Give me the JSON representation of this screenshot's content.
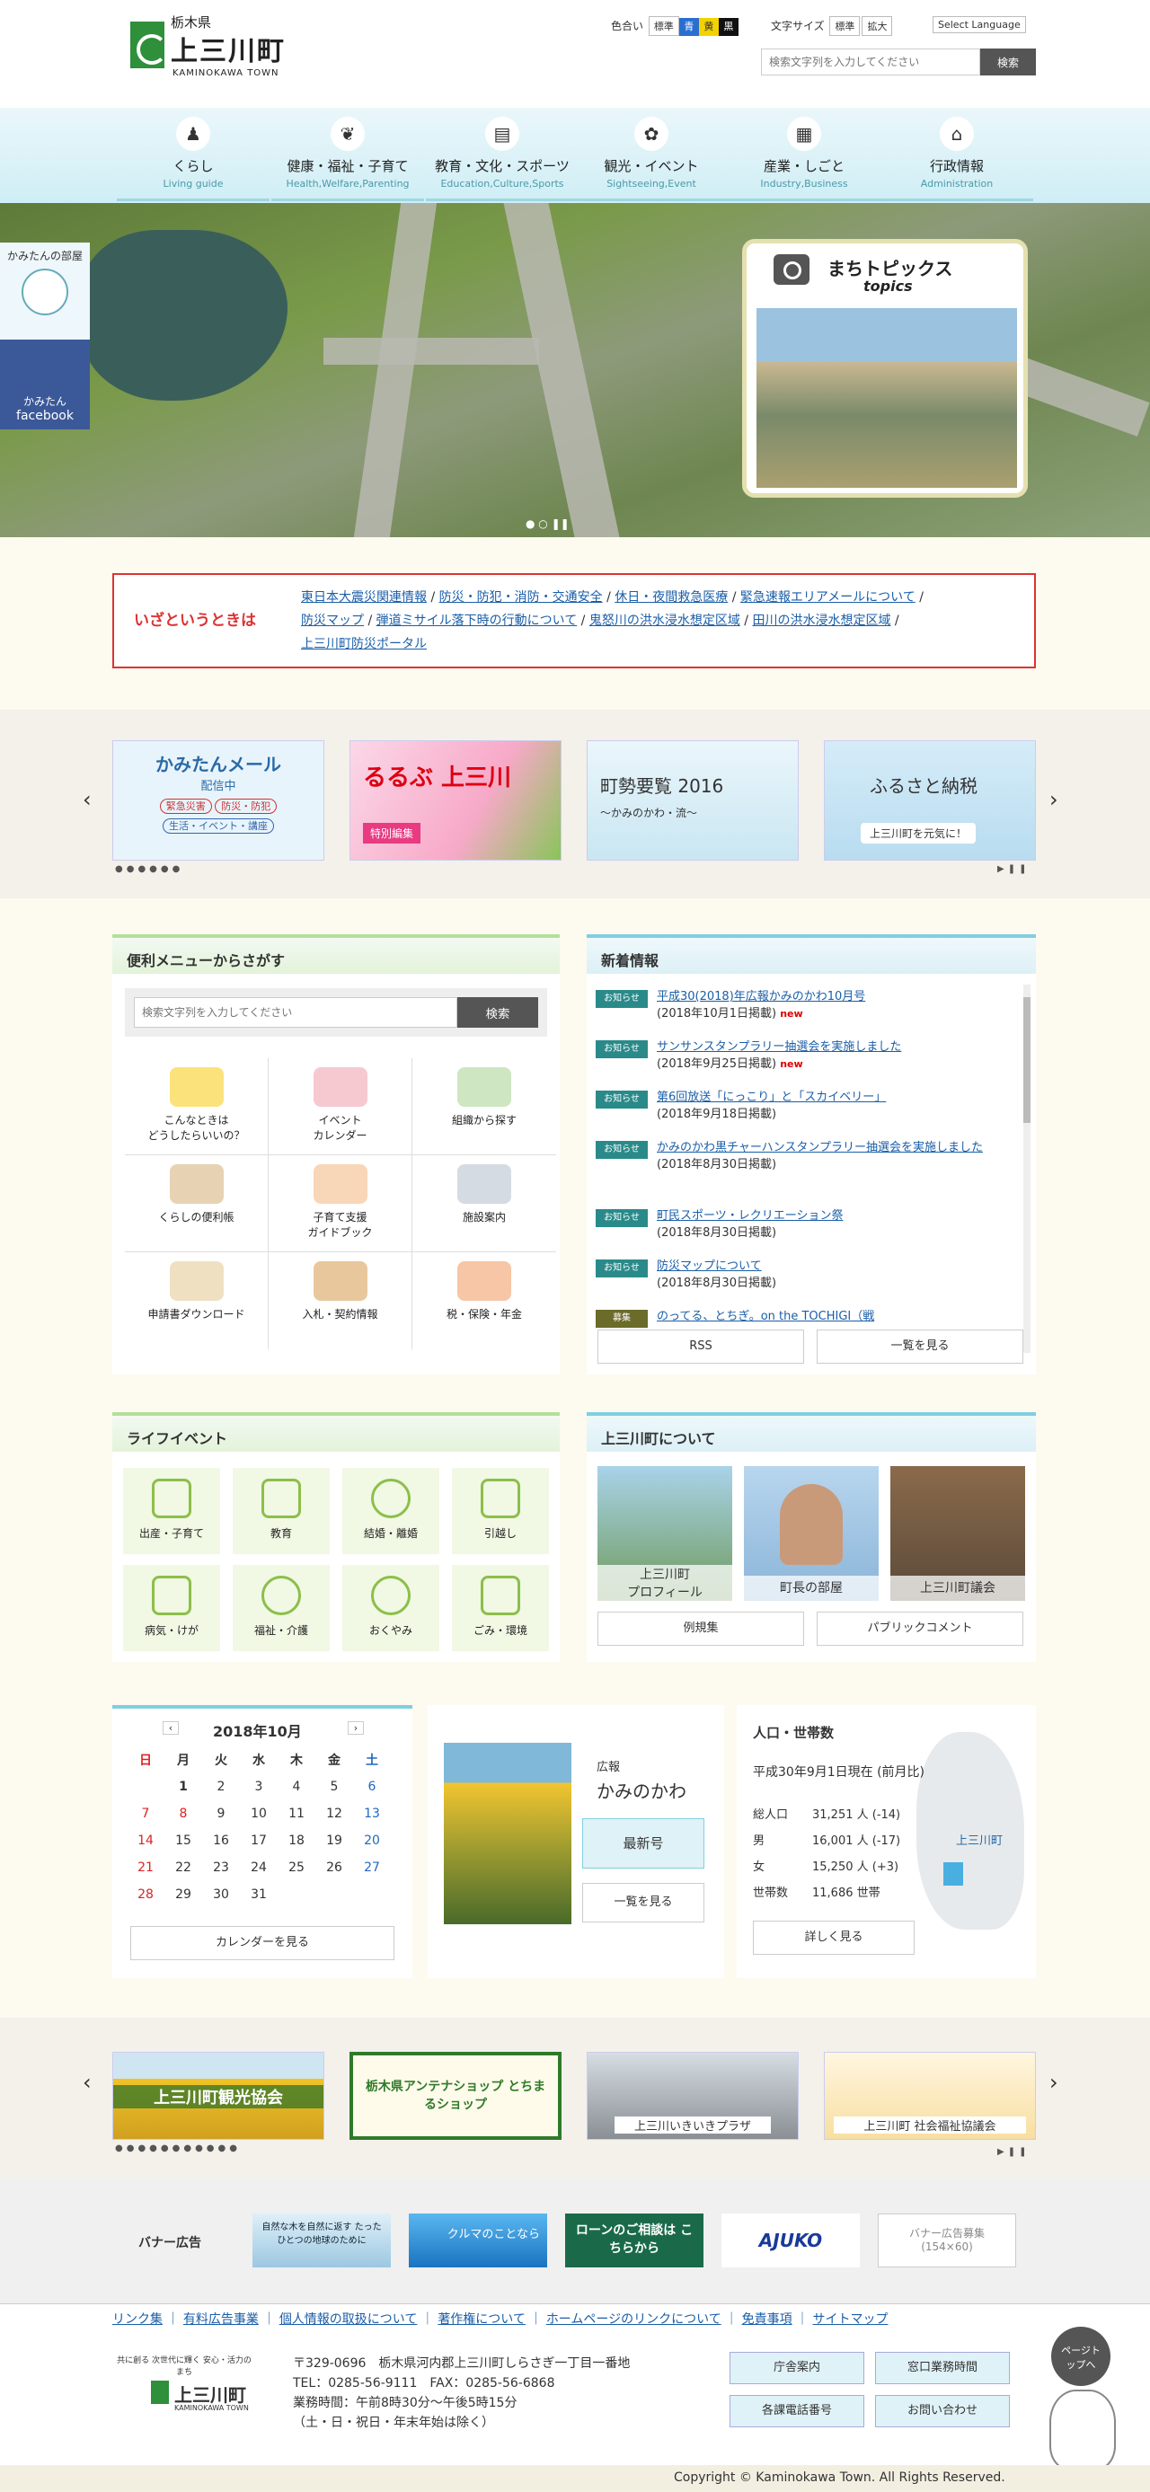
{
  "header": {
    "prefecture": "栃木県",
    "town_name": "上三川町",
    "town_name_en": "KAMINOKAWA TOWN",
    "color_label": "色合い",
    "color_options": [
      "標準",
      "青",
      "黄",
      "黒"
    ],
    "font_label": "文字サイズ",
    "font_options": [
      "標準",
      "拡大"
    ],
    "language": "Select Language",
    "search_placeholder": "検索文字列を入力してください",
    "search_button": "検索"
  },
  "nav": [
    {
      "jp": "くらし",
      "en": "Living guide",
      "icon": "person-icon"
    },
    {
      "jp": "健康・福祉・子育て",
      "en": "Health,Welfare,Parenting",
      "icon": "leaf-icon"
    },
    {
      "jp": "教育・文化・スポーツ",
      "en": "Education,Culture,Sports",
      "icon": "book-icon"
    },
    {
      "jp": "観光・イベント",
      "en": "Sightseeing,Event",
      "icon": "footprint-icon"
    },
    {
      "jp": "産業・しごと",
      "en": "Industry,Business",
      "icon": "building-icon"
    },
    {
      "jp": "行政情報",
      "en": "Administration",
      "icon": "cityhall-icon"
    }
  ],
  "hero": {
    "side_room": "かみたんの部屋",
    "facebook_line1": "かみたん",
    "facebook_line2": "facebook",
    "topics_title": "まちトピックス",
    "topics_sub": "topics"
  },
  "emergency": {
    "label": "いざというときは",
    "links": [
      "東日本大震災関連情報",
      "防災・防犯・消防・交通安全",
      "休日・夜間救急医療",
      "緊急速報エリアメールについて",
      "防災マップ",
      "弾道ミサイル落下時の行動について",
      "鬼怒川の洪水浸水想定区域",
      "田川の洪水浸水想定区域",
      "上三川町防災ポータル"
    ]
  },
  "banners1": [
    {
      "title": "かみたんメール",
      "sub": "配信中",
      "tags": [
        "緊急災害",
        "防災・防犯",
        "生活・イベント・講座"
      ]
    },
    {
      "title": "るるぶ 上三川",
      "sub": "特別編集"
    },
    {
      "title": "町勢要覧 2016",
      "sub": "〜かみのかわ・流〜"
    },
    {
      "title": "ふるさと納税",
      "sub": "上三川町を元気に！"
    }
  ],
  "menu": {
    "title": "便利メニューからさがす",
    "search_placeholder": "検索文字列を入力してください",
    "search_button": "検索",
    "items": [
      {
        "label": "こんなときは\nどうしたらいいの？",
        "icon": "question-icon"
      },
      {
        "label": "イベント\nカレンダー",
        "icon": "calendar-icon"
      },
      {
        "label": "組織から探す",
        "icon": "org-chart-icon"
      },
      {
        "label": "くらしの便利帳",
        "icon": "house-book-icon"
      },
      {
        "label": "子育て支援\nガイドブック",
        "icon": "baby-bottle-icon"
      },
      {
        "label": "施設案内",
        "icon": "facility-icon"
      },
      {
        "label": "申請書ダウンロード",
        "icon": "download-icon"
      },
      {
        "label": "入札・契約情報",
        "icon": "gavel-icon"
      },
      {
        "label": "税・保険・年金",
        "icon": "tax-icon"
      }
    ]
  },
  "news": {
    "title": "新着情報",
    "items": [
      {
        "tag": "お知らせ",
        "title": "平成30(2018)年広報かみのかわ10月号",
        "date": "(2018年10月1日掲載)",
        "new": "new"
      },
      {
        "tag": "お知らせ",
        "title": "サンサンスタンプラリー抽選会を実施しました",
        "date": "(2018年9月25日掲載)",
        "new": "new"
      },
      {
        "tag": "お知らせ",
        "title": "第6回放送「にっこり」と「スカイベリー」",
        "date": "(2018年9月18日掲載)",
        "new": ""
      },
      {
        "tag": "お知らせ",
        "title": "かみのかわ黒チャーハンスタンプラリー抽選会を実施しました",
        "date": "(2018年8月30日掲載)",
        "new": ""
      },
      {
        "tag": "お知らせ",
        "title": "町民スポーツ・レクリエーション祭",
        "date": "(2018年8月30日掲載)",
        "new": ""
      },
      {
        "tag": "お知らせ",
        "title": "防災マップについて",
        "date": "(2018年8月30日掲載)",
        "new": ""
      },
      {
        "tag": "募集",
        "title": "のってる、とちぎ。on the TOCHIGI（戦",
        "date": "",
        "new": ""
      }
    ],
    "rss": "RSS",
    "list": "一覧を見る"
  },
  "life": {
    "title": "ライフイベント",
    "items": [
      "出産・子育て",
      "教育",
      "結婚・離婚",
      "引越し",
      "病気・けが",
      "福祉・介護",
      "おくやみ",
      "ごみ・環境"
    ]
  },
  "about": {
    "title": "上三川町について",
    "cards": [
      "上三川町\nプロフィール",
      "町長の部屋",
      "上三川町議会"
    ],
    "buttons": [
      "例規集",
      "パブリックコメント"
    ]
  },
  "calendar": {
    "month": "2018年10月",
    "weekdays": [
      "日",
      "月",
      "火",
      "水",
      "木",
      "金",
      "土"
    ],
    "weeks": [
      [
        "",
        "1",
        "2",
        "3",
        "4",
        "5",
        "6"
      ],
      [
        "7",
        "8",
        "9",
        "10",
        "11",
        "12",
        "13"
      ],
      [
        "14",
        "15",
        "16",
        "17",
        "18",
        "19",
        "20"
      ],
      [
        "21",
        "22",
        "23",
        "24",
        "25",
        "26",
        "27"
      ],
      [
        "28",
        "29",
        "30",
        "31",
        "",
        "",
        ""
      ]
    ],
    "button": "カレンダーを見る"
  },
  "koho": {
    "label": "広報",
    "title": "かみのかわ",
    "latest": "最新号",
    "list": "一覧を見る"
  },
  "population": {
    "title": "人口・世帯数",
    "date": "平成30年9月1日現在 (前月比)",
    "rows": [
      {
        "label": "総人口",
        "value": "31,251 人 (-14)"
      },
      {
        "label": "男",
        "value": "16,001 人 (-17)"
      },
      {
        "label": "女",
        "value": "15,250 人 (+3)"
      },
      {
        "label": "世帯数",
        "value": "11,686 世帯"
      }
    ],
    "map_label": "上三川町",
    "button": "詳しく見る"
  },
  "banners2": [
    "上三川町観光協会",
    "栃木県アンテナショップ とちまるショップ",
    "上三川いきいきプラザ",
    "上三川町 社会福祉協議会"
  ],
  "ads": {
    "label": "バナー広告",
    "items": [
      "自然な木を自然に返す たったひとつの地球のために",
      "クルマのことなら",
      "ローンのご相談は こちらから",
      "AJUKO"
    ],
    "recruit": "バナー広告募集",
    "recruit_size": "(154×60)"
  },
  "footer": {
    "links": [
      "リンク集",
      "有料広告事業",
      "個人情報の取扱について",
      "著作権について",
      "ホームページのリンクについて",
      "免責事項",
      "サイトマップ"
    ],
    "catch": "共に創る 次世代に輝く 安心・活力のまち",
    "address": "〒329-0696　栃木県河内郡上三川町しらさぎ一丁目一番地",
    "tel": "TEL：0285-56-9111　FAX：0285-56-6868",
    "hours": "業務時間：午前8時30分～午後5時15分",
    "hours_note": "（土・日・祝日・年末年始は除く）",
    "buttons": [
      "庁舎案内",
      "窓口業務時間",
      "各課電話番号",
      "お問い合わせ"
    ],
    "pagetop": "ページトップへ",
    "copyright": "Copyright © Kaminokawa Town. All Rights Reserved."
  }
}
